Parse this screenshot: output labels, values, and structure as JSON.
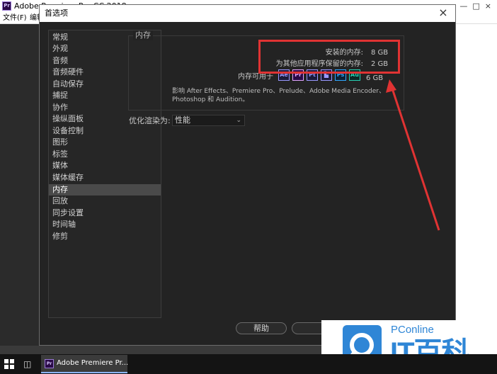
{
  "app": {
    "title": "Adobe Premiere Pro CC 2018",
    "logo": "Pr",
    "menu": [
      "文件(F)",
      "编辑"
    ]
  },
  "dialog": {
    "title": "首选项",
    "close_icon": "×",
    "sidebar": {
      "items": [
        "常规",
        "外观",
        "音频",
        "音频硬件",
        "自动保存",
        "捕捉",
        "协作",
        "操纵面板",
        "设备控制",
        "图形",
        "标签",
        "媒体",
        "媒体缓存",
        "内存",
        "回放",
        "同步设置",
        "时间轴",
        "修剪"
      ],
      "selected": "内存"
    },
    "memory": {
      "group_label": "内存",
      "installed_label": "安装的内存:",
      "installed_value": "8 GB",
      "reserved_label": "为其他应用程序保留的内存:",
      "reserved_value": "2 GB",
      "available_label": "内存可用于",
      "available_value": "6 GB",
      "app_icons": [
        {
          "label": "Ae",
          "color": "#9999ff",
          "bg": "#1a1a3a"
        },
        {
          "label": "Pr",
          "color": "#e2a6ff",
          "bg": "#2a0a47"
        },
        {
          "label": "Pt",
          "color": "#9999ff",
          "bg": "#1a1a3a"
        },
        {
          "label": "▙",
          "color": "#9999ff",
          "bg": "#1a1a3a"
        },
        {
          "label": "Ps",
          "color": "#31a8ff",
          "bg": "#0b2236"
        },
        {
          "label": "Au",
          "color": "#28d0b4",
          "bg": "#0a2a26"
        }
      ],
      "impact_text": "影响 After Effects、Premiere Pro、Prelude、Adobe Media Encoder、Photoshop 和 Audition。"
    },
    "optimize": {
      "label": "优化渲染为:",
      "value": "性能",
      "chevron_icon": "⌄"
    },
    "buttons": {
      "help": "帮助"
    }
  },
  "annotation": {
    "box_color": "#e03333"
  },
  "watermark": {
    "pconline": "PConline",
    "brand": "IT百科"
  },
  "taskbar": {
    "item_label": "Adobe Premiere Pr...",
    "item_icon": "Pr"
  }
}
